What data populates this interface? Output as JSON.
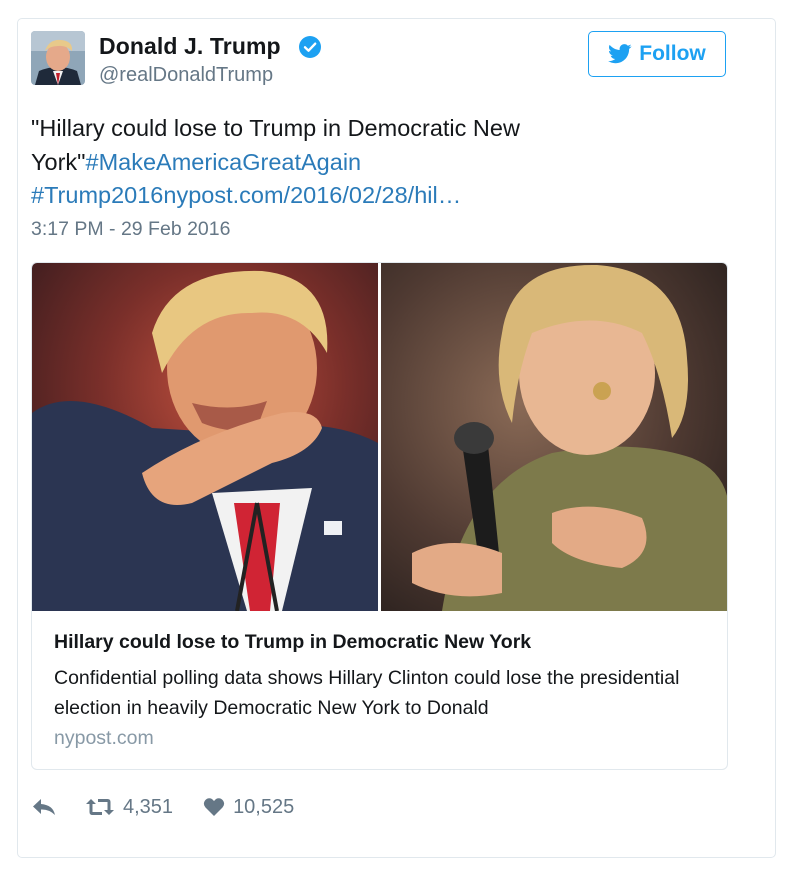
{
  "user": {
    "name": "Donald J. Trump",
    "handle": "@realDonaldTrump",
    "verified": true,
    "verified_color": "#1da1f2"
  },
  "follow_button": {
    "label": "Follow",
    "icon": "twitter-bird-icon",
    "color": "#1da1f2"
  },
  "tweet": {
    "text_quote": "\"Hillary could lose to Trump in Democratic New York\"",
    "hashtag_1": "#MakeAmericaGreatAgain",
    "hashtag_2": "#Trump2016",
    "link": "nypost.com/2016/02/28/hil…",
    "link_color": "#2b7bb9",
    "timestamp": "3:17 PM - 29 Feb 2016"
  },
  "card": {
    "title": "Hillary could lose to Trump in Democratic New York",
    "description": "Confidential polling data shows Hillary Clinton could lose the presidential election in heavily Democratic New York to Donald",
    "domain": "nypost.com"
  },
  "actions": {
    "reply_icon": "reply-icon",
    "retweet_icon": "retweet-icon",
    "retweet_count": "4,351",
    "like_icon": "heart-icon",
    "like_count": "10,525"
  }
}
